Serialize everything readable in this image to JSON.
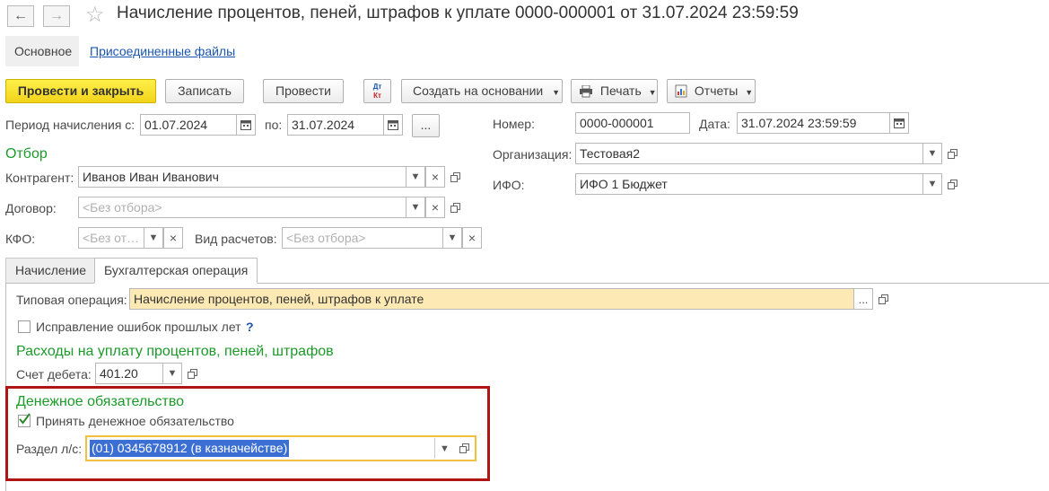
{
  "window": {
    "title": "Начисление процентов, пеней, штрафов к уплате 0000-000001 от 31.07.2024 23:59:59"
  },
  "nav": {
    "back": "←",
    "forward": "→"
  },
  "top_tabs": {
    "main": "Основное",
    "files": "Присоединенные файлы"
  },
  "toolbar": {
    "post_close": "Провести и закрыть",
    "save": "Записать",
    "post": "Провести",
    "dt_kt_top": "Дт",
    "dt_kt_bottom": "Кт",
    "create_based": "Создать на основании",
    "print": "Печать",
    "reports": "Отчеты"
  },
  "period": {
    "from_label": "Период начисления с:",
    "from_value": "01.07.2024",
    "to_label": "по:",
    "to_value": "31.07.2024",
    "more": "..."
  },
  "number": {
    "label": "Номер:",
    "value": "0000-000001"
  },
  "date": {
    "label": "Дата:",
    "value": "31.07.2024 23:59:59"
  },
  "organization": {
    "label": "Организация:",
    "value": "Тестовая2"
  },
  "ifo": {
    "label": "ИФО:",
    "value": "ИФО 1 Бюджет"
  },
  "filter": {
    "heading": "Отбор",
    "counterparty_label": "Контрагент:",
    "counterparty_value": "Иванов Иван Иванович",
    "contract_label": "Договор:",
    "contract_placeholder": "<Без отбора>",
    "kfo_label": "КФО:",
    "kfo_placeholder": "<Без от…",
    "calc_type_label": "Вид расчетов:",
    "calc_type_placeholder": "<Без отбора>"
  },
  "tabs": {
    "accrual": "Начисление",
    "accounting": "Бухгалтерская операция"
  },
  "operation": {
    "label": "Типовая операция:",
    "value": "Начисление процентов, пеней, штрафов к уплате",
    "more": "..."
  },
  "prior_errors": {
    "label": "Исправление ошибок прошлых лет",
    "help": "?"
  },
  "expenses": {
    "heading": "Расходы на уплату процентов, пеней, штрафов",
    "debit_label": "Счет дебета:",
    "debit_value": "401.20"
  },
  "obligation": {
    "heading": "Денежное обязательство",
    "accept_label": "Принять денежное обязательство",
    "section_label": "Раздел л/с:",
    "section_value": "(01) 0345678912 (в казначействе)"
  },
  "colors": {
    "accent_green": "#1c9a2a",
    "highlight_red": "#b01515",
    "primary_yellow": "#f7dd2a"
  }
}
